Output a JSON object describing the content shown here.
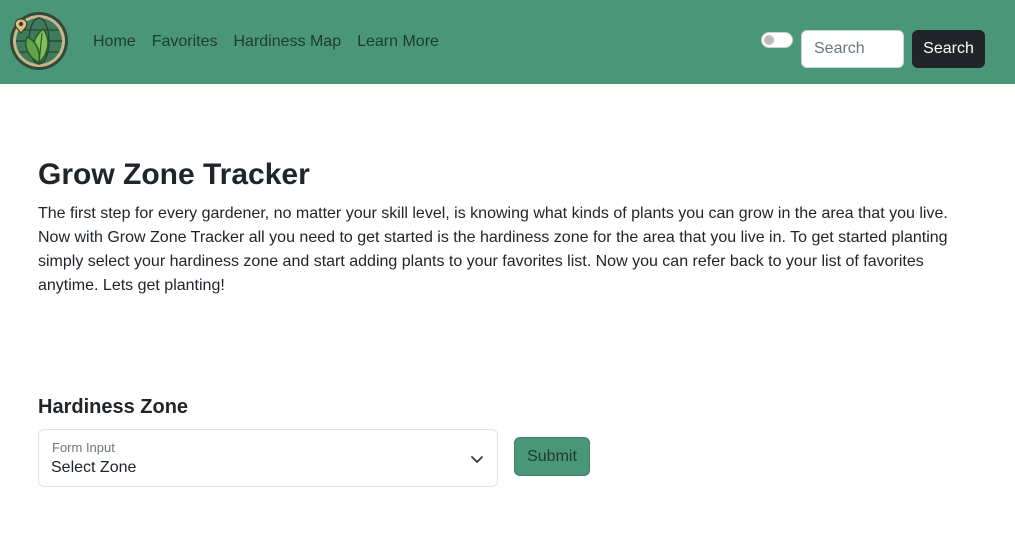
{
  "nav": {
    "links": [
      "Home",
      "Favorites",
      "Hardiness Map",
      "Learn More"
    ],
    "search_placeholder": "Search",
    "search_button": "Search",
    "logo_icon": "globe-leaves-location-pin-icon",
    "theme_toggle_on": false
  },
  "main": {
    "title": "Grow Zone Tracker",
    "intro": "The first step for every gardener, no matter your skill level, is knowing what kinds of plants you can grow in the area that you live. Now with Grow Zone Tracker all you need to get started is the hardiness zone for the area that you live in. To get started planting simply select your hardiness zone and start adding plants to your favorites list. Now you can refer back to your list of favorites anytime. Lets get planting!",
    "zone_heading": "Hardiness Zone",
    "select_label": "Form Input",
    "select_value": "Select Zone",
    "submit_button": "Submit"
  },
  "colors": {
    "navbar": "#4a9678",
    "dark_button": "#212529",
    "submit": "#4a9678"
  }
}
